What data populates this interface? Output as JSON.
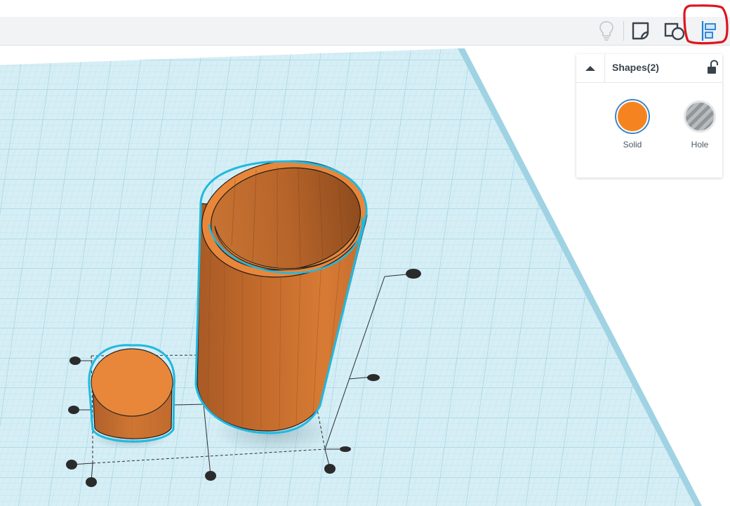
{
  "toolbar": {
    "buttons": [
      {
        "icon": "lightbulb-icon",
        "name": "notes-button"
      },
      {
        "icon": "note-shape-icon",
        "name": "group-button"
      },
      {
        "icon": "combine-icon",
        "name": "ungroup-button"
      },
      {
        "icon": "align-icon",
        "name": "align-button",
        "highlighted": true
      }
    ]
  },
  "inspector": {
    "title": "Shapes(2)",
    "locked": false,
    "options": [
      {
        "label": "Solid",
        "selected": true,
        "color": "#f58420"
      },
      {
        "label": "Hole",
        "selected": false,
        "color": "#9a9ea2"
      }
    ]
  },
  "colors": {
    "workplane": "#cdeaf2",
    "grid_line": "#a9d8e6",
    "shape_orange": "#e8873a",
    "selection_outline": "#1fb9e0",
    "annotation": "#e0141e"
  }
}
